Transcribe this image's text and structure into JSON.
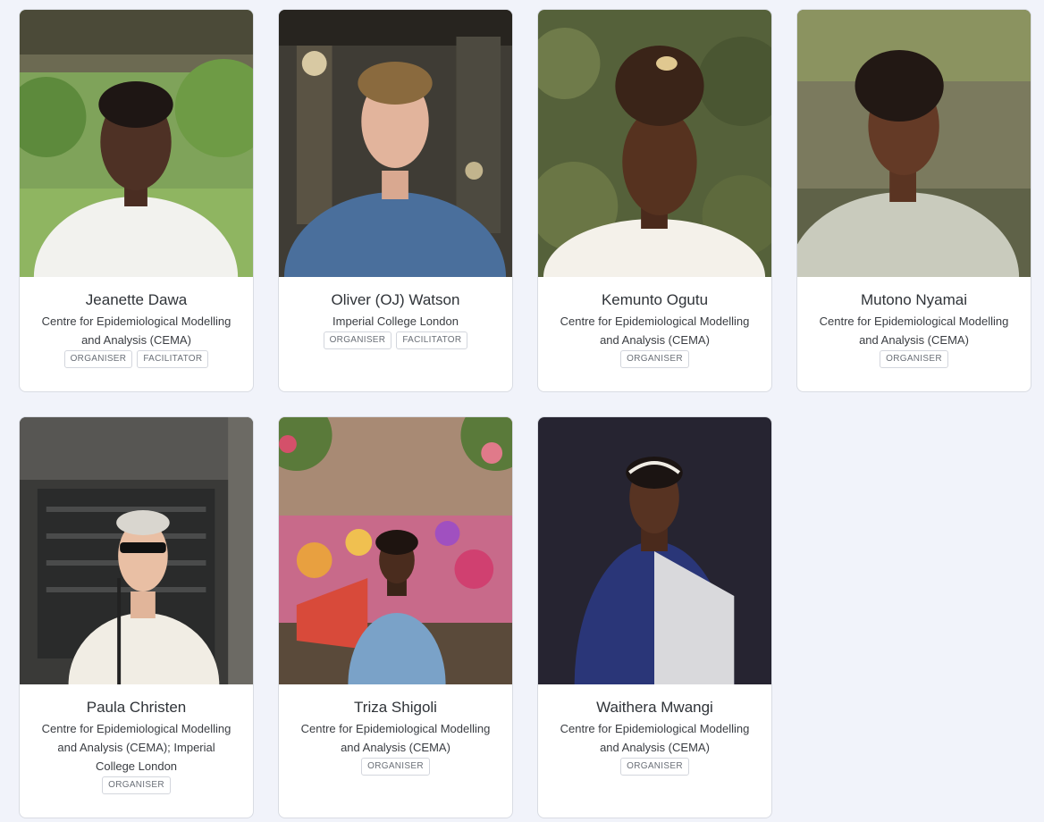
{
  "people": [
    {
      "name": "Jeanette Dawa",
      "affiliation": "Centre for Epidemiological Modelling and Analysis (CEMA)",
      "roles": [
        "ORGANISER",
        "FACILITATOR"
      ]
    },
    {
      "name": "Oliver (OJ) Watson",
      "affiliation": "Imperial College London",
      "roles": [
        "ORGANISER",
        "FACILITATOR"
      ]
    },
    {
      "name": "Kemunto Ogutu",
      "affiliation": "Centre for Epidemiological Modelling and Analysis (CEMA)",
      "roles": [
        "ORGANISER"
      ]
    },
    {
      "name": "Mutono Nyamai",
      "affiliation": "Centre for Epidemiological Modelling and Analysis (CEMA)",
      "roles": [
        "ORGANISER"
      ]
    },
    {
      "name": "Paula Christen",
      "affiliation": "Centre for Epidemiological Modelling and Analysis (CEMA); Imperial College London",
      "roles": [
        "ORGANISER"
      ]
    },
    {
      "name": "Triza Shigoli",
      "affiliation": "Centre for Epidemiological Modelling and Analysis (CEMA)",
      "roles": [
        "ORGANISER"
      ]
    },
    {
      "name": "Waithera Mwangi",
      "affiliation": "Centre for Epidemiological Modelling and Analysis (CEMA)",
      "roles": [
        "ORGANISER"
      ]
    }
  ],
  "colors": {
    "page_background": "#f1f3fa",
    "card_background": "#ffffff",
    "card_border": "#d9dce3",
    "tag_text": "#6a6f77"
  }
}
